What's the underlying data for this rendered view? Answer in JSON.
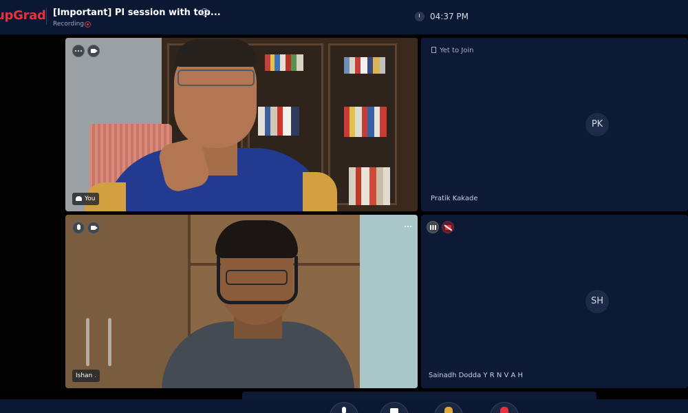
{
  "header": {
    "logo": "upGrad",
    "title": "[Important] PI session with top...",
    "recording_label": "Recording",
    "time": "04:37 PM"
  },
  "tiles": {
    "you": {
      "name": "You"
    },
    "pratik": {
      "status": "Yet to Join",
      "initials": "PK",
      "name": "Pratik Kakade"
    },
    "ishan": {
      "name": "Ishan ."
    },
    "sainadh": {
      "initials": "SH",
      "name": "Sainadh Dodda Y R N V A H"
    }
  },
  "colors": {
    "brand": "#e8313a",
    "header_bg": "#0b1833",
    "tile_bg": "#0c1a35",
    "cam_off": "#e8313a",
    "share": "#e8313a"
  },
  "icons": {
    "info": "info-circle-icon",
    "recording": "record-dot-icon",
    "clock": "clock-icon",
    "more": "more-dots-icon",
    "camera": "camera-icon",
    "mic": "microphone-icon",
    "audio_level": "audio-bars-icon",
    "camera_off": "camera-off-icon",
    "yet_to_join": "door-icon",
    "raise_hand": "hand-icon",
    "share": "share-icon"
  }
}
